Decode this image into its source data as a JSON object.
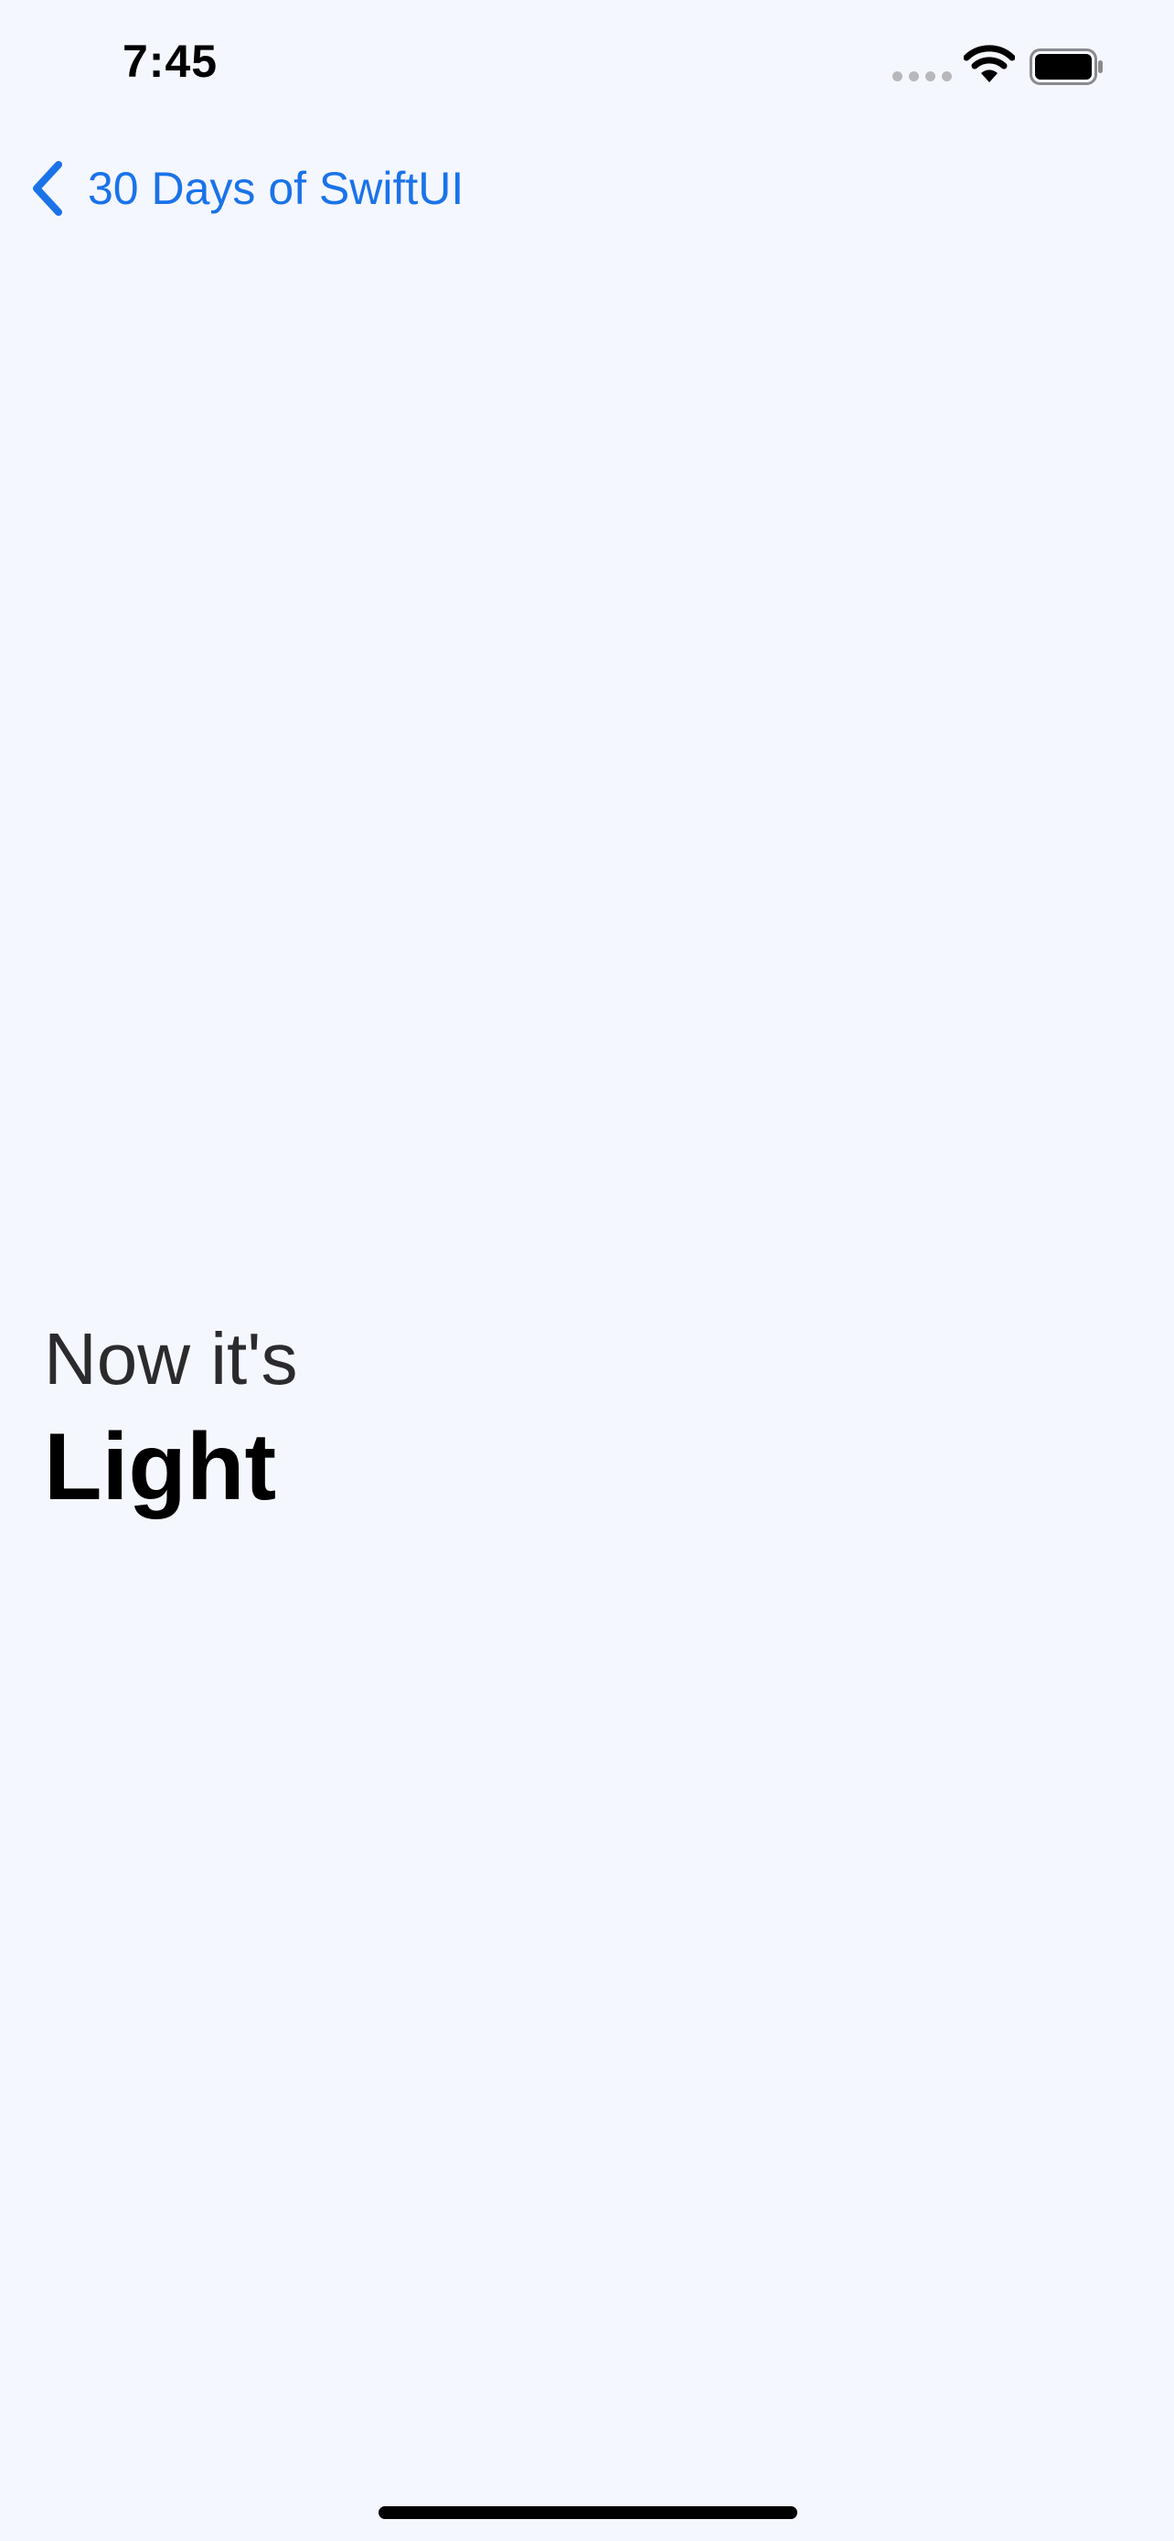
{
  "status_bar": {
    "time": "7:45",
    "icons": [
      "cellular-signal-icon",
      "wifi-icon",
      "battery-icon"
    ]
  },
  "nav": {
    "back_label": "30 Days of SwiftUI",
    "back_icon": "chevron-left-icon"
  },
  "content": {
    "subtitle": "Now it's",
    "title": "Light"
  },
  "colors": {
    "background": "#f5f7fe",
    "accent": "#1a73e8",
    "title": "#000000",
    "subtitle": "#2b2b2e"
  }
}
